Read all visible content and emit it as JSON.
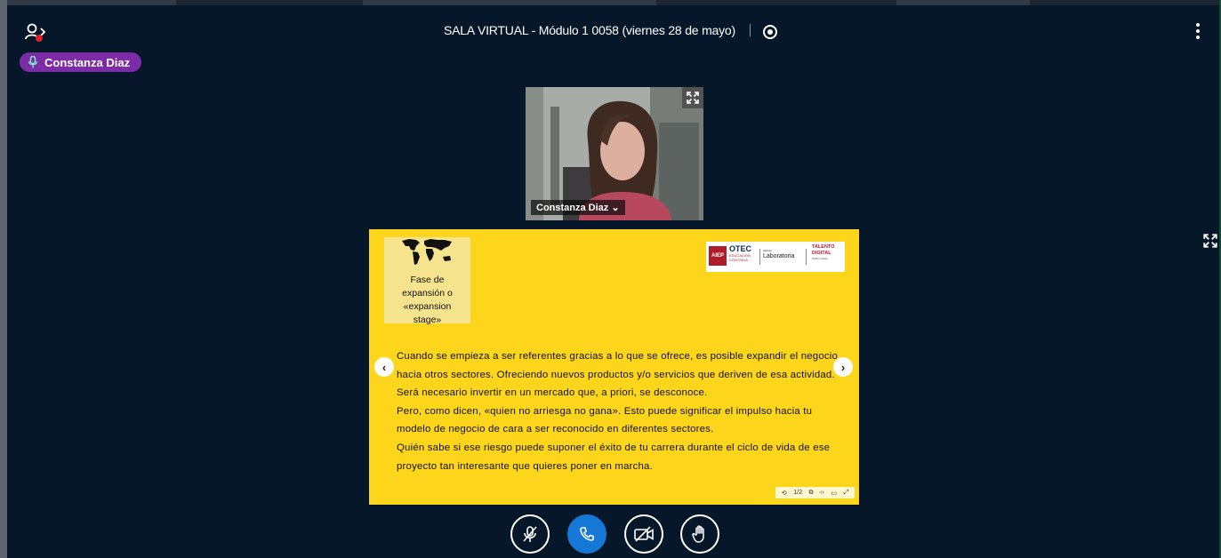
{
  "meeting": {
    "title": "SALA VIRTUAL - Módulo 1 0058 (viernes 28 de mayo)"
  },
  "talking_indicator": {
    "name": "Constanza Diaz"
  },
  "video": {
    "name": "Constanza Diaz",
    "name_caret": "⌄"
  },
  "slide": {
    "phase_caption": [
      "Fase de",
      "expansión o",
      "«expansion",
      "stage»"
    ],
    "logos": {
      "aiep": "AIEP",
      "otec": "OTEC",
      "otec_sub": [
        "EDUCACIÓN",
        "CONTINUA"
      ],
      "laboratoria_prefix": "Alianza",
      "laboratoria": "Laboratoria",
      "talento": [
        "TALENTO",
        "DIGITAL"
      ],
      "talento_sub": "PARA CHILE"
    },
    "paragraphs": [
      "Cuando se empieza a ser referentes gracias a lo que se ofrece, es posible expandir el negocio hacia otros sectores.  Ofreciendo nuevos productos y/o servicios que deriven de esa actividad. Será necesario invertir en un mercado que, a priori, se desconoce.",
      "Pero, como dicen, «quien no arriesga no gana». Esto puede significar el impulso hacia tu modelo de negocio de cara a ser reconocido en diferentes sectores.",
      "Quién sabe si ese riesgo puede suponer el éxito de tu carrera durante el ciclo de vida de ese proyecto tan interesante que quieres poner en marcha."
    ],
    "prev_glyph": "‹",
    "next_glyph": "›"
  },
  "slide_tools": [
    {
      "icon": "refresh-icon",
      "glyph": "⟲"
    },
    {
      "icon": "page-number-icon",
      "glyph": "1/2"
    },
    {
      "icon": "copy-icon",
      "glyph": "⧉"
    },
    {
      "icon": "code-icon",
      "glyph": "‹›"
    },
    {
      "icon": "window-icon",
      "glyph": "▭"
    },
    {
      "icon": "expand-icon",
      "glyph": "⤢"
    }
  ],
  "controls": [
    {
      "icon": "microphone-muted-icon",
      "label": "mute"
    },
    {
      "icon": "phone-icon",
      "label": "audio"
    },
    {
      "icon": "video-off-icon",
      "label": "video"
    },
    {
      "icon": "raise-hand-icon",
      "label": "raise hand"
    }
  ],
  "colors": {
    "background": "#06172a",
    "talking_badge": "#7c2ca6",
    "slide": "#fdd51a",
    "phone_button": "#1678d6",
    "recording_dot": "#e21f26"
  }
}
